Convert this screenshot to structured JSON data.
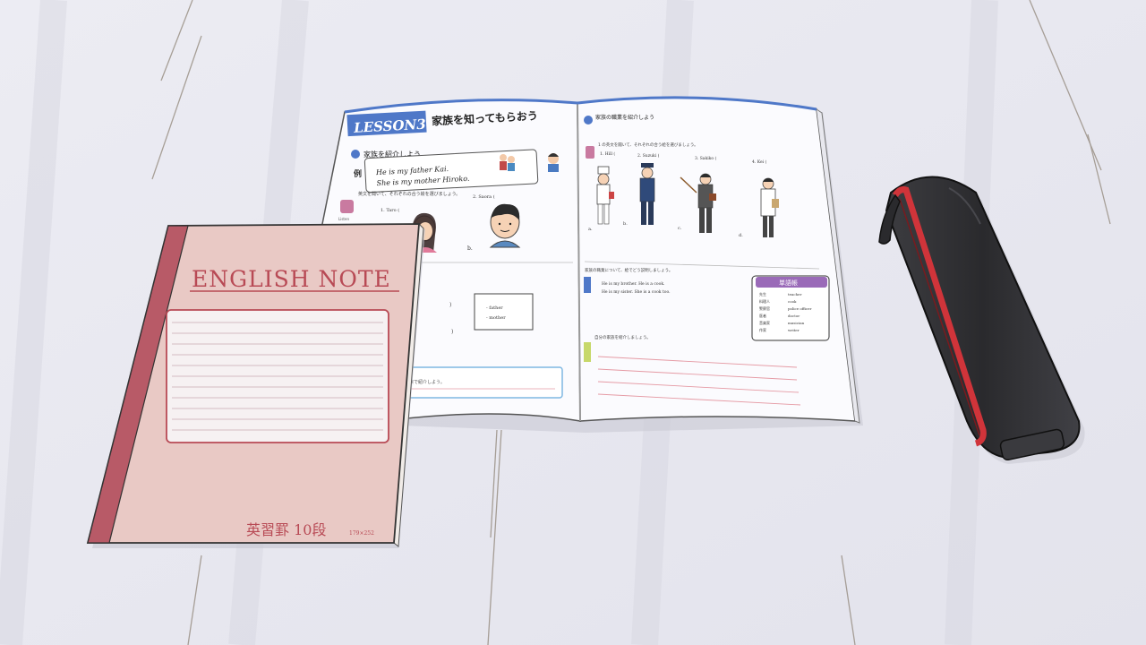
{
  "textbook": {
    "lesson_badge": "LESSON3",
    "lesson_title": "家族を知ってもらおう",
    "section1_title": "家族を紹介しよう",
    "example_mark": "例",
    "example_line1": "He is my father Kai.",
    "example_line2": "She is my mother Hiroko.",
    "listen_label": "Listen",
    "instruction_left": "英文を聞いて、それぞれの合う絵を選びましょう。",
    "names_left": [
      "1. Taro (",
      "2. Saora ("
    ],
    "letter_b": "b.",
    "word_box": [
      "- father",
      "- mother"
    ],
    "right_section_title": "家族の職業を紹介しよう",
    "right_instruction": "1 の英文を聞いて、それぞれの合う絵を選びましょう。",
    "right_names": [
      "1. Hill (",
      "2. Suzuki (",
      "3. Sakiko (",
      "4. Kei ("
    ],
    "right_letters": [
      "a.",
      "b.",
      "c.",
      "d."
    ],
    "right_instruction2": "家族の職業について、絵でどう説明しましょう。",
    "sentence1": "He is my brother. He is a cook.",
    "sentence2": "He is my sister. She is a cook too.",
    "vocab_title": "単語帳",
    "vocab": [
      [
        "先生",
        "teacher"
      ],
      [
        "料理人",
        "cook"
      ],
      [
        "警察官",
        "police officer"
      ],
      [
        "医者",
        "doctor"
      ],
      [
        "音楽家",
        "musician"
      ],
      [
        "作家",
        "writer"
      ]
    ],
    "right_instruction3": "自分の家族を紹介しましょう。",
    "left_bottom_instruction": "家族で紹介しよう。"
  },
  "notebook": {
    "title": "ENGLISH NOTE",
    "footer": "英習罫 10段",
    "size_label": "179×252"
  },
  "colors": {
    "background": "#e9e9f1",
    "notebook_cover": "#e9c9c5",
    "notebook_spine": "#b85a67",
    "notebook_text": "#b84a55",
    "lesson_blue": "#4f78c8",
    "vocab_purple": "#9a6ab8",
    "pencil_case": "#2f2f32",
    "zipper_red": "#d0343a"
  }
}
